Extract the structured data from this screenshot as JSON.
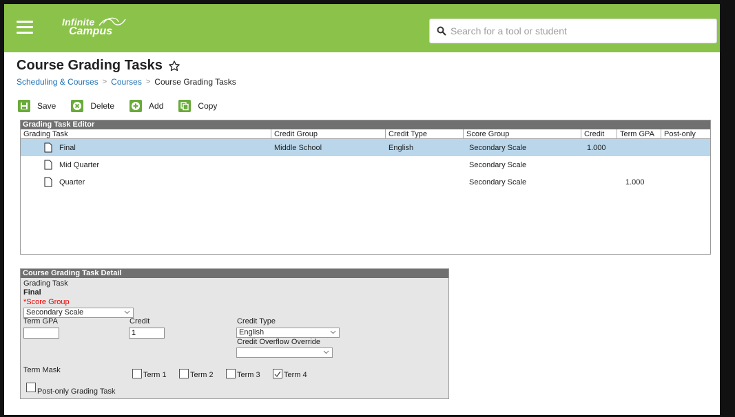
{
  "header": {
    "logo_line1": "Infinite",
    "logo_line2": "Campus",
    "search_placeholder": "Search for a tool or student"
  },
  "page": {
    "title": "Course Grading Tasks",
    "breadcrumb": [
      "Scheduling & Courses",
      "Courses",
      "Course Grading Tasks"
    ]
  },
  "toolbar": {
    "save": "Save",
    "delete": "Delete",
    "add": "Add",
    "copy": "Copy"
  },
  "editor": {
    "title": "Grading Task Editor",
    "columns": [
      "Grading Task",
      "Credit Group",
      "Credit Type",
      "Score Group",
      "Credit",
      "Term GPA",
      "Post-only"
    ],
    "rows": [
      {
        "task": "Final",
        "credit_group": "Middle School",
        "credit_type": "English",
        "score_group": "Secondary Scale",
        "credit": "1.000",
        "term_gpa": "",
        "post_only": "",
        "selected": true
      },
      {
        "task": "Mid Quarter",
        "credit_group": "",
        "credit_type": "",
        "score_group": "Secondary Scale",
        "credit": "",
        "term_gpa": "",
        "post_only": "",
        "selected": false
      },
      {
        "task": "Quarter",
        "credit_group": "",
        "credit_type": "",
        "score_group": "Secondary Scale",
        "credit": "",
        "term_gpa": "1.000",
        "post_only": "",
        "selected": false
      }
    ]
  },
  "detail": {
    "title": "Course Grading Task Detail",
    "grading_task_label": "Grading Task",
    "grading_task_value": "Final",
    "score_group_label": "*Score Group",
    "score_group_value": "Secondary Scale",
    "term_gpa_label": "Term GPA",
    "term_gpa_value": "",
    "credit_label": "Credit",
    "credit_value": "1",
    "credit_type_label": "Credit Type",
    "credit_type_value": "English",
    "credit_overflow_label": "Credit Overflow Override",
    "credit_overflow_value": "",
    "term_mask_label": "Term Mask",
    "terms": [
      {
        "label": "Term 1",
        "checked": false
      },
      {
        "label": "Term 2",
        "checked": false
      },
      {
        "label": "Term 3",
        "checked": false
      },
      {
        "label": "Term 4",
        "checked": true
      }
    ],
    "post_only_label": "Post-only Grading Task",
    "post_only_checked": false
  },
  "colors": {
    "topbar": "#8bc34a",
    "toolbar_icon": "#6aaa3a",
    "selected_row": "#b9d6ea",
    "required": "#ee0000",
    "link": "#1a6fb5"
  }
}
